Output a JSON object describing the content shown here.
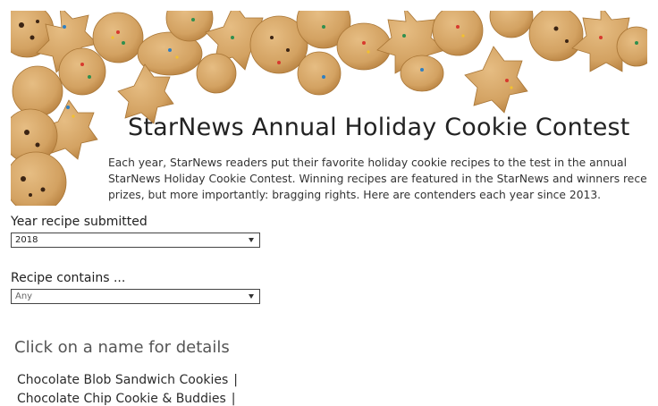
{
  "header": {
    "title": "StarNews Annual Holiday Cookie Contest",
    "intro_lines": [
      "Each year, StarNews readers put their favorite holiday cookie recipes to the test in the annual",
      "StarNews Holiday Cookie Contest. Winning recipes are featured in the StarNews and winners receive",
      "prizes, but more importantly: bragging rights. Here are contenders each year since 2013."
    ]
  },
  "filters": {
    "year": {
      "label": "Year recipe submitted",
      "value": "2018"
    },
    "contains": {
      "label": "Recipe contains ...",
      "value": "Any"
    }
  },
  "details": {
    "heading": "Click on a name for details",
    "separator": "|",
    "items": [
      "Chocolate Blob Sandwich Cookies",
      "Chocolate Chip Cookie & Buddies"
    ]
  },
  "colors": {
    "cookie": "#d7a869",
    "cookie_dark": "#b98342",
    "sprinkle_red": "#d8392e",
    "sprinkle_green": "#2f8f4e",
    "sprinkle_blue": "#2f7fc1",
    "sprinkle_yellow": "#f2c12e"
  }
}
